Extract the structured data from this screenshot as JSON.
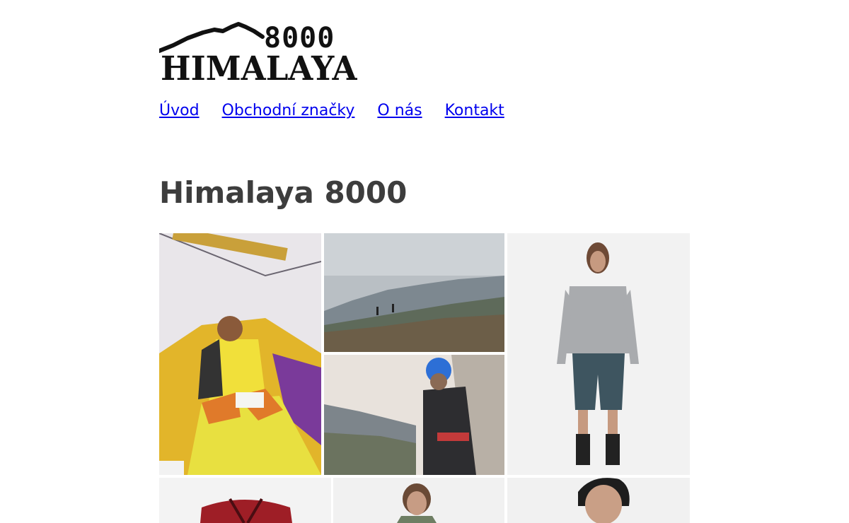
{
  "logo": {
    "top_text": "8000",
    "main_text": "HIMALAYA",
    "icon": "mountain-ridge-icon"
  },
  "nav": {
    "items": [
      {
        "label": "Úvod"
      },
      {
        "label": "Obchodní značky"
      },
      {
        "label": "O nás"
      },
      {
        "label": "Kontakt"
      }
    ]
  },
  "page": {
    "title": "Himalaya 8000"
  },
  "gallery": {
    "images": [
      {
        "subject": "person reading in yellow tent"
      },
      {
        "subject": "hikers on misty mountain ridge"
      },
      {
        "subject": "climber with blue helmet"
      },
      {
        "subject": "man in grey hoodie and shorts"
      },
      {
        "subject": "red backpack"
      },
      {
        "subject": "person in green jacket"
      },
      {
        "subject": "person portrait"
      }
    ]
  },
  "colors": {
    "link": "#0000ee",
    "heading": "#3d3d3d"
  }
}
